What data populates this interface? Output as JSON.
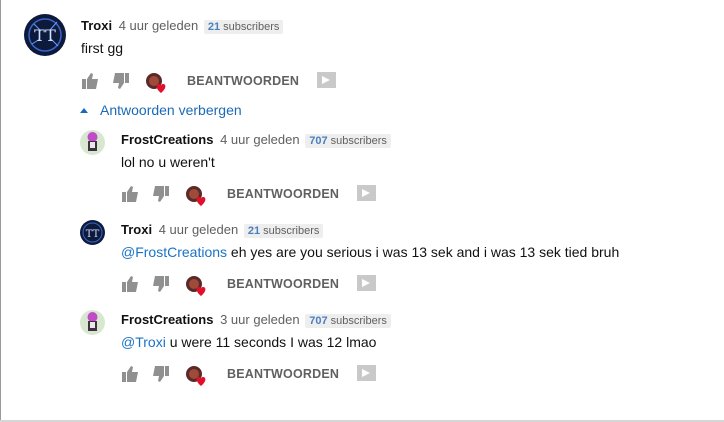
{
  "comments": [
    {
      "author": "Troxi",
      "time": "4 uur geleden",
      "subs_count": "21",
      "subs_label": "subscribers",
      "text": "first gg",
      "reply_label": "BEANTWOORDEN"
    },
    {
      "author": "FrostCreations",
      "time": "4 uur geleden",
      "subs_count": "707",
      "subs_label": "subscribers",
      "text": "lol no u weren't",
      "reply_label": "BEANTWOORDEN"
    },
    {
      "author": "Troxi",
      "time": "4 uur geleden",
      "subs_count": "21",
      "subs_label": "subscribers",
      "mention": "@FrostCreations",
      "text": "eh yes are you serious i was 13 sek and i was 13 sek tied bruh",
      "reply_label": "BEANTWOORDEN"
    },
    {
      "author": "FrostCreations",
      "time": "3 uur geleden",
      "subs_count": "707",
      "subs_label": "subscribers",
      "mention": "@Troxi",
      "text": "u were 11 seconds I was 12 lmao",
      "reply_label": "BEANTWOORDEN"
    }
  ],
  "replies_toggle": "Antwoorden verbergen",
  "icons": [
    "thumbs-up-icon",
    "thumbs-down-icon",
    "creator-heart-icon",
    "flag-icon"
  ],
  "colors": {
    "link": "#1b6ab8",
    "mention": "#1a73c6",
    "subs_count": "#4a7fc0",
    "heart": "#e0102a"
  }
}
